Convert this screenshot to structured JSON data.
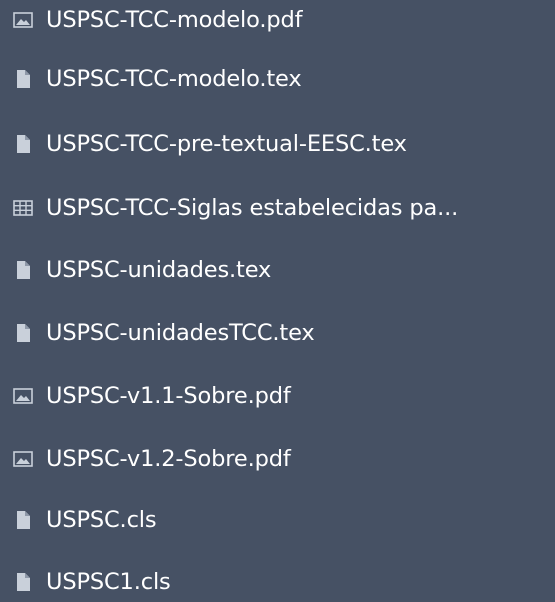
{
  "file_list": {
    "items": [
      {
        "name": "USPSC-TCC-modelo.pdf",
        "icon": "image-icon"
      },
      {
        "name": "USPSC-TCC-modelo.tex",
        "icon": "file-icon"
      },
      {
        "name": "USPSC-TCC-pre-textual-EESC.tex",
        "icon": "file-icon"
      },
      {
        "name": "USPSC-TCC-Siglas estabelecidas pa...",
        "icon": "table-icon"
      },
      {
        "name": "USPSC-unidades.tex",
        "icon": "file-icon"
      },
      {
        "name": "USPSC-unidadesTCC.tex",
        "icon": "file-icon"
      },
      {
        "name": "USPSC-v1.1-Sobre.pdf",
        "icon": "image-icon"
      },
      {
        "name": "USPSC-v1.2-Sobre.pdf",
        "icon": "image-icon"
      },
      {
        "name": "USPSC.cls",
        "icon": "file-icon"
      },
      {
        "name": "USPSC1.cls",
        "icon": "file-icon"
      }
    ]
  },
  "colors": {
    "background": "#465164",
    "text": "#ffffff",
    "icon": "#c9d0da"
  }
}
